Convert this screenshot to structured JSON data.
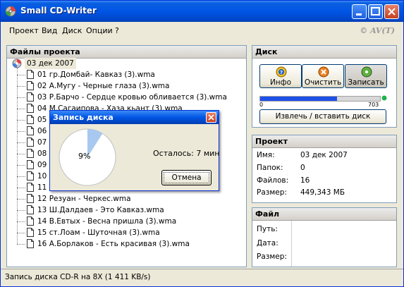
{
  "window": {
    "title": "Small CD-Writer",
    "brand": "© AV(T)"
  },
  "menu": [
    "Проект",
    "Вид",
    "Диск",
    "Опции",
    "?"
  ],
  "project_files": {
    "header": "Файлы проекта",
    "root": "03 дек 2007",
    "files": [
      {
        "label": "01 гр.Домбай- Кавказ (3).wma"
      },
      {
        "label": "02 А.Мугу - Черные глаза (3).wma"
      },
      {
        "label": "03 Р.Барчо - Сердце кровью обливается (3).wma"
      },
      {
        "label": "04 М.Сагаипова - Хаза кьант (3).wma"
      },
      {
        "label": "05"
      },
      {
        "label": "06"
      },
      {
        "label": "07"
      },
      {
        "label": "08"
      },
      {
        "label": "09"
      },
      {
        "label": "10"
      },
      {
        "label": "11"
      },
      {
        "label": "12 Резуан - Черкес.wma"
      },
      {
        "label": "13 Ш.Далдаев - Это Кавказ.wma"
      },
      {
        "label": "14 В.Евтых - Весна пришла (3).wma"
      },
      {
        "label": "15 ст.Лоам - Шуточная (3).wma"
      },
      {
        "label": "16 А.Борлаков - Есть красивая (3).wma"
      }
    ]
  },
  "disk": {
    "header": "Диск",
    "buttons": {
      "info": "Инфо",
      "clear": "Очистить",
      "write": "Записать"
    },
    "capacity": {
      "min": "0",
      "max": "703",
      "used_fraction": 0.64
    },
    "eject": "Извлечь / вставить диск"
  },
  "project": {
    "header": "Проект",
    "rows": [
      {
        "label": "Имя:",
        "value": "03 дек 2007"
      },
      {
        "label": "Папок:",
        "value": "0"
      },
      {
        "label": "Файлов:",
        "value": "16"
      },
      {
        "label": "Размер:",
        "value": "449,343 МБ"
      }
    ]
  },
  "file": {
    "header": "Файл",
    "rows": [
      {
        "label": "Путь:"
      },
      {
        "label": "Дата:"
      },
      {
        "label": "Размер:"
      }
    ]
  },
  "dialog": {
    "title": "Запись диска",
    "progress_percent": 9,
    "progress_label": "9%",
    "remaining": "Осталось: 7 мин",
    "cancel": "Отмена"
  },
  "status": "Запись диска CD-R на 8X (1 411 KB/s)",
  "colors": {
    "titlebar": "#0055e5",
    "capacity_fill": "#1e50e8",
    "pie_fill": "#a8c8f0",
    "led": "#22b14c"
  }
}
